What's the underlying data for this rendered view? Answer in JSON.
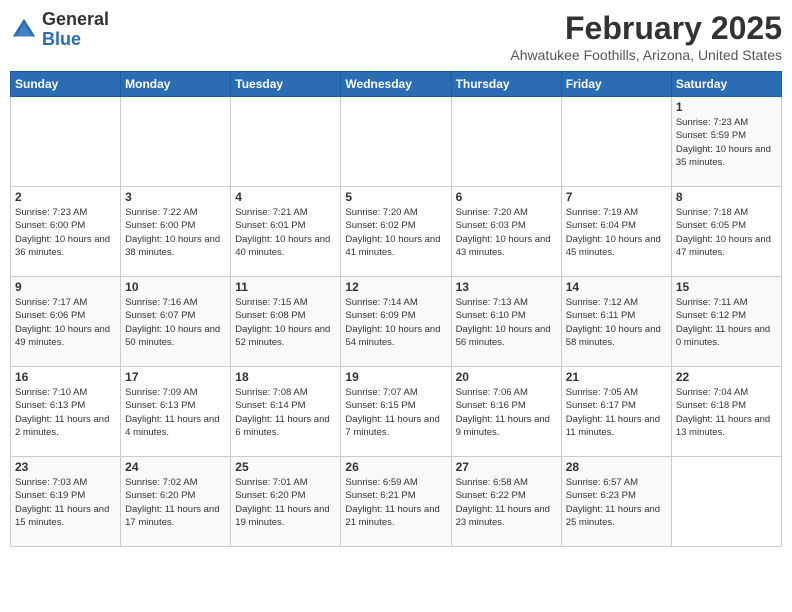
{
  "header": {
    "logo_general": "General",
    "logo_blue": "Blue",
    "month_year": "February 2025",
    "location": "Ahwatukee Foothills, Arizona, United States"
  },
  "days_of_week": [
    "Sunday",
    "Monday",
    "Tuesday",
    "Wednesday",
    "Thursday",
    "Friday",
    "Saturday"
  ],
  "weeks": [
    [
      {
        "day": "",
        "info": ""
      },
      {
        "day": "",
        "info": ""
      },
      {
        "day": "",
        "info": ""
      },
      {
        "day": "",
        "info": ""
      },
      {
        "day": "",
        "info": ""
      },
      {
        "day": "",
        "info": ""
      },
      {
        "day": "1",
        "info": "Sunrise: 7:23 AM\nSunset: 5:59 PM\nDaylight: 10 hours and 35 minutes."
      }
    ],
    [
      {
        "day": "2",
        "info": "Sunrise: 7:23 AM\nSunset: 6:00 PM\nDaylight: 10 hours and 36 minutes."
      },
      {
        "day": "3",
        "info": "Sunrise: 7:22 AM\nSunset: 6:00 PM\nDaylight: 10 hours and 38 minutes."
      },
      {
        "day": "4",
        "info": "Sunrise: 7:21 AM\nSunset: 6:01 PM\nDaylight: 10 hours and 40 minutes."
      },
      {
        "day": "5",
        "info": "Sunrise: 7:20 AM\nSunset: 6:02 PM\nDaylight: 10 hours and 41 minutes."
      },
      {
        "day": "6",
        "info": "Sunrise: 7:20 AM\nSunset: 6:03 PM\nDaylight: 10 hours and 43 minutes."
      },
      {
        "day": "7",
        "info": "Sunrise: 7:19 AM\nSunset: 6:04 PM\nDaylight: 10 hours and 45 minutes."
      },
      {
        "day": "8",
        "info": "Sunrise: 7:18 AM\nSunset: 6:05 PM\nDaylight: 10 hours and 47 minutes."
      }
    ],
    [
      {
        "day": "9",
        "info": "Sunrise: 7:17 AM\nSunset: 6:06 PM\nDaylight: 10 hours and 49 minutes."
      },
      {
        "day": "10",
        "info": "Sunrise: 7:16 AM\nSunset: 6:07 PM\nDaylight: 10 hours and 50 minutes."
      },
      {
        "day": "11",
        "info": "Sunrise: 7:15 AM\nSunset: 6:08 PM\nDaylight: 10 hours and 52 minutes."
      },
      {
        "day": "12",
        "info": "Sunrise: 7:14 AM\nSunset: 6:09 PM\nDaylight: 10 hours and 54 minutes."
      },
      {
        "day": "13",
        "info": "Sunrise: 7:13 AM\nSunset: 6:10 PM\nDaylight: 10 hours and 56 minutes."
      },
      {
        "day": "14",
        "info": "Sunrise: 7:12 AM\nSunset: 6:11 PM\nDaylight: 10 hours and 58 minutes."
      },
      {
        "day": "15",
        "info": "Sunrise: 7:11 AM\nSunset: 6:12 PM\nDaylight: 11 hours and 0 minutes."
      }
    ],
    [
      {
        "day": "16",
        "info": "Sunrise: 7:10 AM\nSunset: 6:13 PM\nDaylight: 11 hours and 2 minutes."
      },
      {
        "day": "17",
        "info": "Sunrise: 7:09 AM\nSunset: 6:13 PM\nDaylight: 11 hours and 4 minutes."
      },
      {
        "day": "18",
        "info": "Sunrise: 7:08 AM\nSunset: 6:14 PM\nDaylight: 11 hours and 6 minutes."
      },
      {
        "day": "19",
        "info": "Sunrise: 7:07 AM\nSunset: 6:15 PM\nDaylight: 11 hours and 7 minutes."
      },
      {
        "day": "20",
        "info": "Sunrise: 7:06 AM\nSunset: 6:16 PM\nDaylight: 11 hours and 9 minutes."
      },
      {
        "day": "21",
        "info": "Sunrise: 7:05 AM\nSunset: 6:17 PM\nDaylight: 11 hours and 11 minutes."
      },
      {
        "day": "22",
        "info": "Sunrise: 7:04 AM\nSunset: 6:18 PM\nDaylight: 11 hours and 13 minutes."
      }
    ],
    [
      {
        "day": "23",
        "info": "Sunrise: 7:03 AM\nSunset: 6:19 PM\nDaylight: 11 hours and 15 minutes."
      },
      {
        "day": "24",
        "info": "Sunrise: 7:02 AM\nSunset: 6:20 PM\nDaylight: 11 hours and 17 minutes."
      },
      {
        "day": "25",
        "info": "Sunrise: 7:01 AM\nSunset: 6:20 PM\nDaylight: 11 hours and 19 minutes."
      },
      {
        "day": "26",
        "info": "Sunrise: 6:59 AM\nSunset: 6:21 PM\nDaylight: 11 hours and 21 minutes."
      },
      {
        "day": "27",
        "info": "Sunrise: 6:58 AM\nSunset: 6:22 PM\nDaylight: 11 hours and 23 minutes."
      },
      {
        "day": "28",
        "info": "Sunrise: 6:57 AM\nSunset: 6:23 PM\nDaylight: 11 hours and 25 minutes."
      },
      {
        "day": "",
        "info": ""
      }
    ]
  ]
}
